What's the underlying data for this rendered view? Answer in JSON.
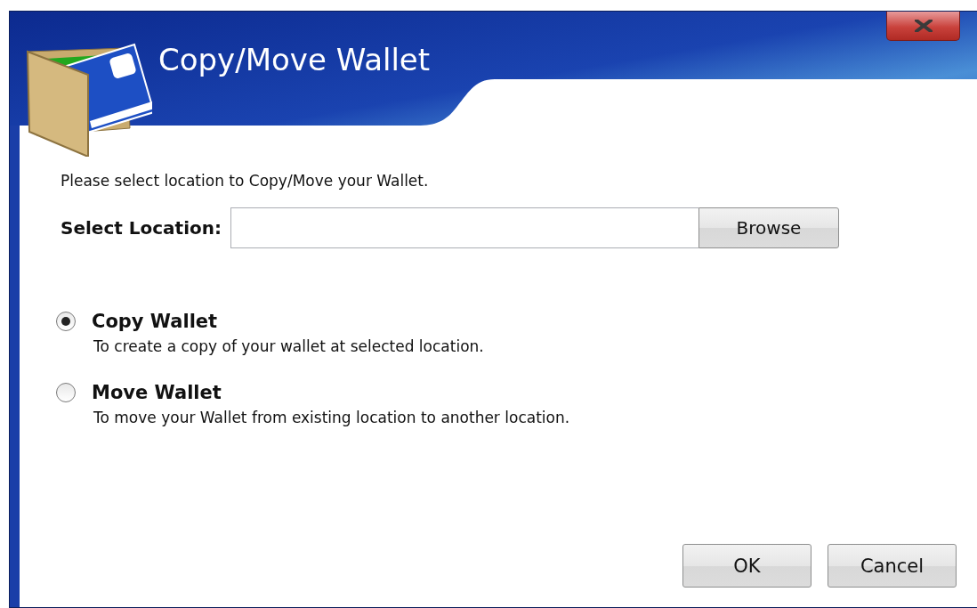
{
  "window": {
    "title": "Copy/Move Wallet"
  },
  "instruction": "Please select location to Copy/Move your Wallet.",
  "location": {
    "label": "Select Location:",
    "button": "Browse"
  },
  "options": [
    {
      "label": "Copy Wallet",
      "description": "To create a copy of your wallet at selected location.",
      "selected": true
    },
    {
      "label": "Move Wallet",
      "description": "To move your Wallet from existing location to another location.",
      "selected": false
    }
  ],
  "buttons": [
    "OK",
    "Cancel"
  ]
}
